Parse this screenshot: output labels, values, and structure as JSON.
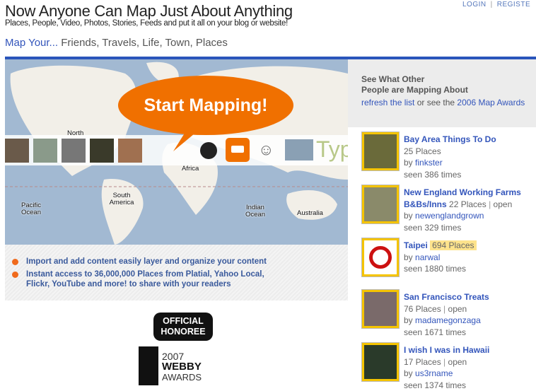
{
  "header": {
    "title": "Now Anyone Can Map Just About Anything",
    "subtitle": "Places, People, Video, Photos, Stories, Feeds and put it all on your blog or website!",
    "tagline_lead": "Map Your...",
    "tagline_rest": " Friends, Travels, Life, Town, Places",
    "login": "LOGIN",
    "sep": "|",
    "register": "REGISTE"
  },
  "map": {
    "cta": "Start Mapping!",
    "labels": {
      "north": "North",
      "africa": "Africa",
      "south_america": "South America",
      "pacific": "Pacific Ocean",
      "indian": "Indian Ocean",
      "australia": "Australia"
    },
    "typepad": "Typ"
  },
  "features": [
    "Import and add content easily layer and organize your content",
    "Instant access to 36,000,000 Places from Platial, Yahoo Local, Flickr, YouTube and more! to share with your readers"
  ],
  "award": {
    "line1": "OFFICIAL",
    "line2": "HONOREE",
    "year": "2007",
    "name": "WEBBY",
    "awards": "AWARDS"
  },
  "sidebar": {
    "heading1": "See What Other",
    "heading2": "People are Mapping About",
    "refresh": "refresh the list",
    "or_see": " or see the ",
    "awards_link": "2006 Map Awards",
    "items": [
      {
        "title": "Bay Area Things To Do",
        "places": "25 Places",
        "by": "by ",
        "author": "finkster",
        "seen": "seen 386 times"
      },
      {
        "title": "New England Working Farms",
        "title2": "B&Bs/Inns",
        "places": "22 Places",
        "open": "open",
        "by": "by ",
        "author": "newenglandgrown",
        "seen": "seen 329 times"
      },
      {
        "title": "Taipei",
        "places": "694 Places",
        "by": "by ",
        "author": "narwal",
        "seen": "seen 1880 times"
      },
      {
        "title": "San Francisco Treats",
        "places": "76 Places",
        "open": "open",
        "by": "by ",
        "author": "madamegonzaga",
        "seen": "seen 1671 times"
      },
      {
        "title": "I wish I was in Hawaii",
        "places": "17 Places",
        "open": "open",
        "by": "by ",
        "author": "us3rname",
        "seen": "seen 1374 times"
      }
    ]
  },
  "colors": {
    "accent": "#2a55bb",
    "link": "#3355bb",
    "cta": "#f07000",
    "thumb_border": "#f5c400"
  }
}
